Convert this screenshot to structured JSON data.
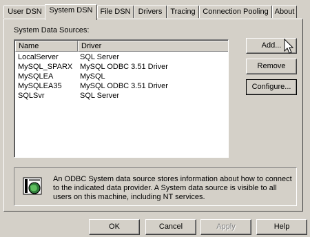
{
  "tabs": [
    {
      "label": "User DSN",
      "active": false
    },
    {
      "label": "System DSN",
      "active": true
    },
    {
      "label": "File DSN",
      "active": false
    },
    {
      "label": "Drivers",
      "active": false
    },
    {
      "label": "Tracing",
      "active": false
    },
    {
      "label": "Connection Pooling",
      "active": false
    },
    {
      "label": "About",
      "active": false
    }
  ],
  "section_label": "System Data Sources:",
  "list": {
    "columns": [
      "Name",
      "Driver"
    ],
    "rows": [
      {
        "name": "LocalServer",
        "driver": "SQL Server"
      },
      {
        "name": "MySQL_SPARX",
        "driver": "MySQL ODBC 3.51 Driver"
      },
      {
        "name": "MySQLEA",
        "driver": "MySQL"
      },
      {
        "name": "MySQLEA35",
        "driver": "MySQL ODBC 3.51 Driver"
      },
      {
        "name": "SQLSvr",
        "driver": "SQL Server"
      }
    ]
  },
  "side_buttons": {
    "add": "Add...",
    "remove": "Remove",
    "configure": "Configure..."
  },
  "info": {
    "icon": "odbc-datasource-icon",
    "text": "An ODBC System data source stores information about how to connect to the indicated data provider.  A System data source is visible to all users on this machine, including NT services."
  },
  "footer": {
    "ok": "OK",
    "cancel": "Cancel",
    "apply": "Apply",
    "help": "Help"
  }
}
